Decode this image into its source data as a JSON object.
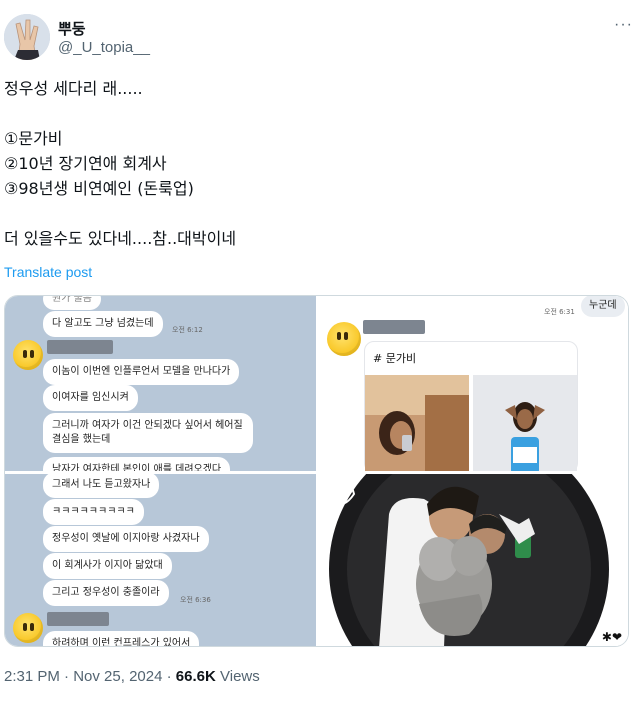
{
  "author": {
    "display_name": "뿌둥",
    "handle": "@_U_topia__",
    "avatar_icon": "hand-sign-avatar-icon"
  },
  "more_icon": "···",
  "tweet": {
    "lines": [
      "정우성 세다리 래.....",
      "",
      "①문가비",
      "②10년 장기연애 회계사",
      "③98년생 비연예인 (돈룩업)",
      "",
      "더 있을수도 있다네....참..대박이네"
    ]
  },
  "translate_label": "Translate post",
  "media": {
    "top_left": {
      "bubbles": [
        "다 알고도 그냥 넘겼는데",
        "이놈이 이번엔 인플루언서 모델을 만나다가",
        "이여자를 임신시켜",
        "그러니까 여자가 이건 안되겠다 싶어서 헤어질 결심을 했는데",
        "남자가 여자한테 본인이 애를 데려오겠다"
      ],
      "time": "오전 6:12",
      "top_partial": "뭔가 물음"
    },
    "top_right": {
      "reply_bubble": "누군데",
      "time": "오전 6:31",
      "card_title": "# 문가비"
    },
    "bottom_left": {
      "bubbles": [
        "그래서 나도 듣고왔자나",
        "ㅋㅋㅋㅋㅋㅋㅋㅋㅋ",
        "정우성이 옛날에 이지아랑 사겼자나",
        "이 회계사가 이지아 닮았대",
        "그리고 정우성이 충졸이라",
        "하려하며 이런 컨프레스가 있어서"
      ],
      "time": "오전 6:36"
    },
    "bottom_right": {
      "sticker_icon": "bird-doodle-icon"
    }
  },
  "meta": {
    "time": "2:31 PM",
    "separator": "·",
    "date": "Nov 25, 2024",
    "views_count": "66.6K",
    "views_label": "Views"
  }
}
